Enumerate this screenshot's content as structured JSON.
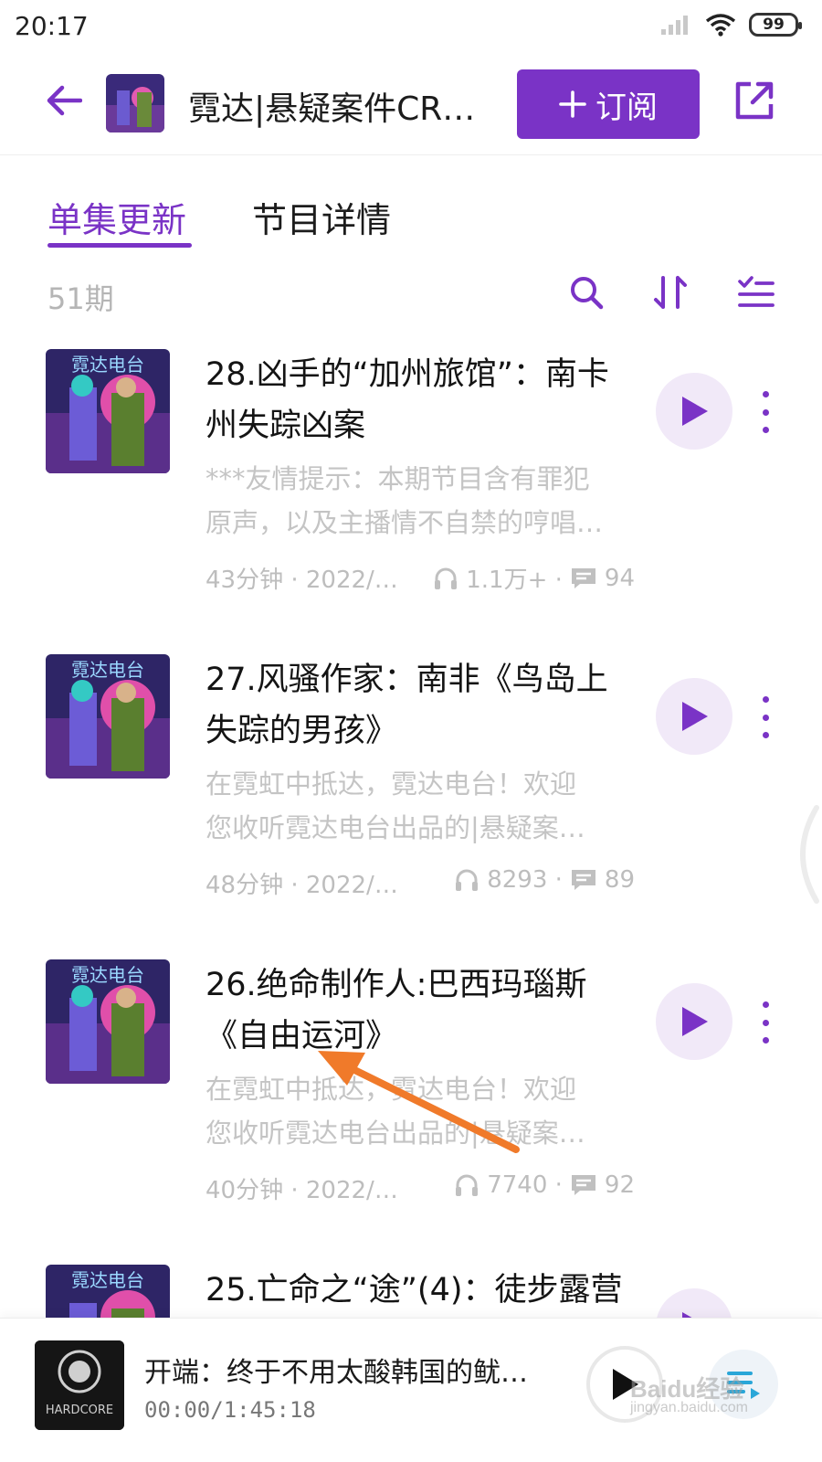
{
  "status_bar": {
    "time": "20:17",
    "battery": "99"
  },
  "header": {
    "title": "霓达|悬疑案件CR…",
    "subscribe_label": "订阅",
    "accent_color": "#7a33c6"
  },
  "tabs": [
    {
      "label": "单集更新",
      "active": true
    },
    {
      "label": "节目详情",
      "active": false
    }
  ],
  "toolbar": {
    "episode_count": "51期"
  },
  "episodes": [
    {
      "title": "28.凶手的“加州旅馆”：南卡州失踪凶案",
      "desc_line1": "***友情提示：本期节目含有罪犯",
      "desc_line2": "原声，以及主播情不自禁的哼唱…",
      "duration_date": "43分钟 · 2022/…",
      "plays": "1.1万+ ·",
      "comments": "94"
    },
    {
      "title": "27.风骚作家：南非《鸟岛上失踪的男孩》",
      "desc_line1": "在霓虹中抵达，霓达电台！欢迎",
      "desc_line2": "您收听霓达电台出品的|悬疑案…",
      "duration_date": "48分钟 · 2022/0…",
      "plays": "8293 ·",
      "comments": "89"
    },
    {
      "title": "26.绝命制作人:巴西玛瑙斯《自由运河》",
      "desc_line1": "在霓虹中抵达，霓达电台！欢迎",
      "desc_line2": "您收听霓达电台出品的|悬疑案…",
      "duration_date": "40分钟 · 2022/0…",
      "plays": "7740 ·",
      "comments": "92"
    },
    {
      "title": "25.亡命之“途”(4)：徒步露营",
      "desc_line1": "",
      "desc_line2": "",
      "duration_date": "",
      "plays": "",
      "comments": ""
    }
  ],
  "player": {
    "title": "开端：终于不用太酸韩国的鱿…",
    "time": "00:00/1:45:18"
  },
  "watermark": {
    "line1": "Baidu经验",
    "line2": "jingyan.baidu.com"
  }
}
